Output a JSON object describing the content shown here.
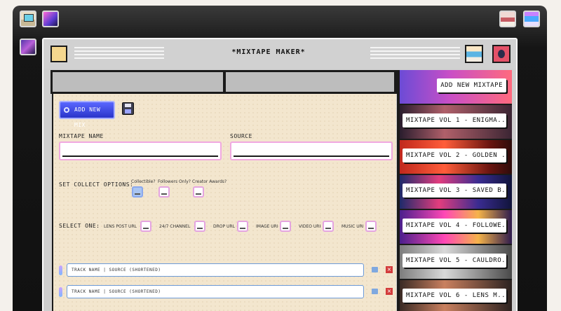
{
  "window": {
    "title": "*MIXTAPE MAKER*"
  },
  "form": {
    "add_new_mix": "ADD NEW MIX",
    "mixtape_name_label": "MIXTAPE NAME",
    "mixtape_name_value": "",
    "source_label": "SOURCE",
    "source_value": "",
    "collect_options_label": "SET COLLECT OPTIONS:",
    "collect_options": [
      {
        "label": "Collectible?",
        "checked": true
      },
      {
        "label": "Followers Only?",
        "checked": false
      },
      {
        "label": "Creator Awards?",
        "checked": false
      }
    ],
    "select_one_label": "SELECT ONE:",
    "select_options": [
      {
        "label": "LENS POST URL"
      },
      {
        "label": "24/7 CHANNEL"
      },
      {
        "label": "DROP URL"
      },
      {
        "label": "IMAGE URI"
      },
      {
        "label": "VIDEO URI"
      },
      {
        "label": "MUSIC URI"
      }
    ],
    "tracks": [
      {
        "placeholder": "TRACK NAME | SOURCE (SHORTENED)"
      },
      {
        "placeholder": "TRACK NAME | SOURCE (SHORTENED)"
      }
    ]
  },
  "sidebar": {
    "items": [
      {
        "label": "ADD NEW MIXTAPE"
      },
      {
        "label": "MIXTAPE VOL 1 - ENIGMA..."
      },
      {
        "label": "MIXTAPE VOL 2 - GOLDEN ..."
      },
      {
        "label": "MIXTAPE VOL 3 - SAVED B..."
      },
      {
        "label": "MIXTAPE VOL 4 - FOLLOWE..."
      },
      {
        "label": "MIXTAPE VOL 5 - CAULDRO..."
      },
      {
        "label": "MIXTAPE VOL 6 - LENS M..."
      }
    ]
  }
}
